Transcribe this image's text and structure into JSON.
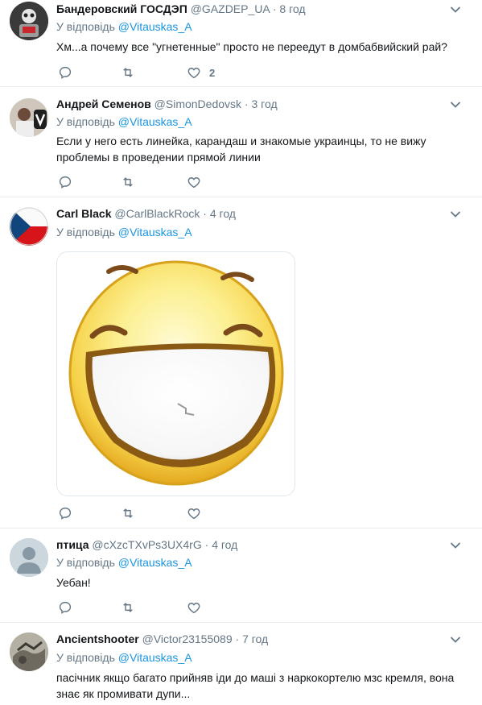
{
  "reply_prefix": "У відповідь",
  "tweets": [
    {
      "name": "Бандеровский ГОСДЭП",
      "handle": "@GAZDEP_UA",
      "time": "8 год",
      "reply_to": "@Vitauskas_A",
      "text": "Хм...а почему все \"угнетенные\" просто не переедут в домбабвийский рай?",
      "likes": "2"
    },
    {
      "name": "Андрей Семенов",
      "handle": "@SimonDedovsk",
      "time": "3 год",
      "reply_to": "@Vitauskas_A",
      "text": "Если у него есть линейка, карандаш и знакомые украинцы, то не вижу проблемы в проведении прямой линии"
    },
    {
      "name": "Carl Black",
      "handle": "@CarlBlackRock",
      "time": "4 год",
      "reply_to": "@Vitauskas_A"
    },
    {
      "name": "птица",
      "handle": "@cXzcTXvPs3UX4rG",
      "time": "4 год",
      "reply_to": "@Vitauskas_A",
      "text": "Уебан!"
    },
    {
      "name": "Ancientshooter",
      "handle": "@Victor23155089",
      "time": "7 год",
      "reply_to": "@Vitauskas_A",
      "text": "пасічник якщо багато прийняв іди до маші з наркокортелю мзс кремля, вона знає як промивати дупи..."
    }
  ],
  "colors": {
    "link": "#1b95e0",
    "secondary": "#657786",
    "divider": "#e6ecf0"
  },
  "icons": [
    "chevron-down-icon",
    "reply-icon",
    "retweet-icon",
    "like-icon"
  ]
}
